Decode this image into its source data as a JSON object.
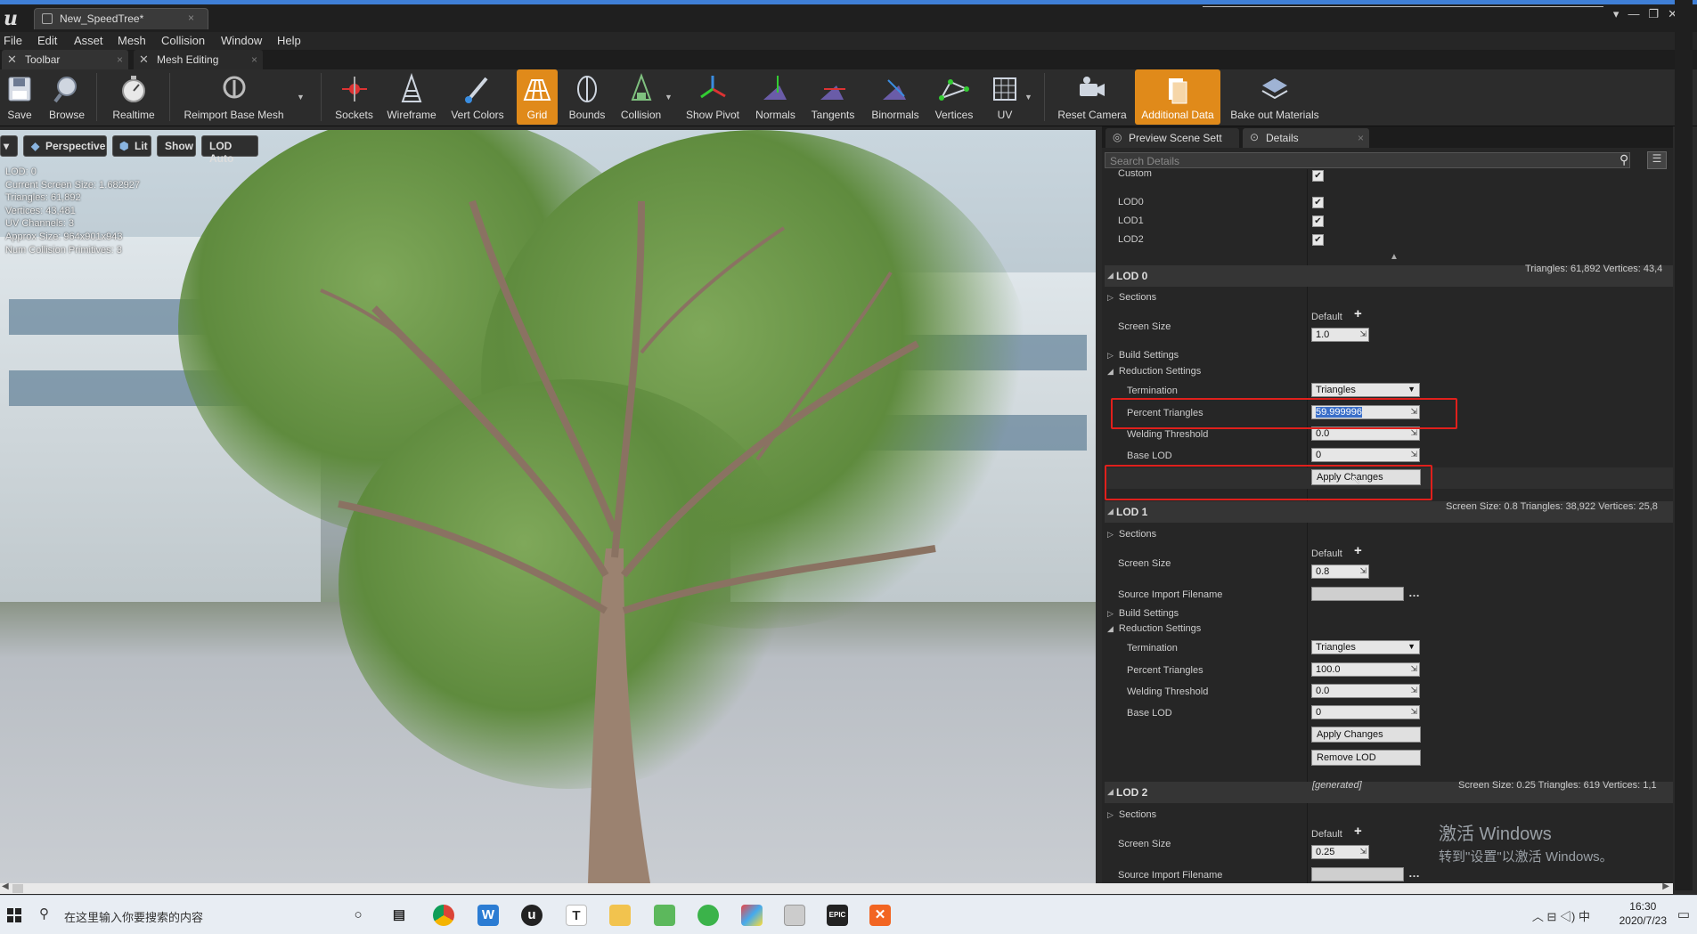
{
  "window": {
    "tab_title": "New_SpeedTree*",
    "tab_close": "×",
    "controls": [
      "▾",
      "—",
      "❐",
      "✕"
    ]
  },
  "menu": [
    "File",
    "Edit",
    "Asset",
    "Mesh",
    "Collision",
    "Window",
    "Help"
  ],
  "panel_tabs": [
    {
      "label": "Toolbar",
      "close": "×"
    },
    {
      "label": "Mesh Editing",
      "close": "×"
    }
  ],
  "toolbar": [
    {
      "label": "Save",
      "icon": "save-icon"
    },
    {
      "label": "Browse",
      "icon": "browse-icon"
    },
    {
      "label": "Realtime",
      "icon": "realtime-icon"
    },
    {
      "label": "Reimport Base Mesh",
      "icon": "reimport-icon"
    },
    {
      "label": "Sockets",
      "icon": "sockets-icon"
    },
    {
      "label": "Wireframe",
      "icon": "wireframe-icon"
    },
    {
      "label": "Vert Colors",
      "icon": "vert-colors-icon"
    },
    {
      "label": "Grid",
      "icon": "grid-icon",
      "active": true
    },
    {
      "label": "Bounds",
      "icon": "bounds-icon"
    },
    {
      "label": "Collision",
      "icon": "collision-icon"
    },
    {
      "label": "Show Pivot",
      "icon": "pivot-icon"
    },
    {
      "label": "Normals",
      "icon": "normals-icon"
    },
    {
      "label": "Tangents",
      "icon": "tangents-icon"
    },
    {
      "label": "Binormals",
      "icon": "binormals-icon"
    },
    {
      "label": "Vertices",
      "icon": "vertices-icon"
    },
    {
      "label": "UV",
      "icon": "uv-icon"
    },
    {
      "label": "Reset Camera",
      "icon": "reset-camera-icon"
    },
    {
      "label": "Additional Data",
      "icon": "additional-data-icon",
      "active": true
    },
    {
      "label": "Bake out Materials",
      "icon": "bake-icon"
    }
  ],
  "viewport": {
    "buttons": [
      "Perspective",
      "Lit",
      "Show",
      "LOD Auto"
    ],
    "stats": [
      "LOD:  0",
      "Current Screen Size:  1.682927",
      "Triangles:  61,892",
      "Vertices:  43,481",
      "UV Channels:  3",
      "Approx Size: 964x901x943",
      "Num Collision Primitives:  3"
    ]
  },
  "details": {
    "tabs": [
      "Preview Scene Sett",
      "Details"
    ],
    "search_placeholder": "Search Details",
    "top_rows": [
      {
        "label": "Custom",
        "checked": "✔"
      },
      {
        "label": "LOD0",
        "checked": "✔"
      },
      {
        "label": "LOD1",
        "checked": "✔"
      },
      {
        "label": "LOD2",
        "checked": "✔"
      }
    ],
    "lod0": {
      "title": "LOD 0",
      "info": "Triangles: 61,892    Vertices: 43,4",
      "sections": "Sections",
      "screen_size_label": "Screen Size",
      "default_label": "Default",
      "screen_size": "1.0",
      "build_settings": "Build Settings",
      "reduction_settings": "Reduction Settings",
      "termination_label": "Termination",
      "termination": "Triangles",
      "percent_label": "Percent Triangles",
      "percent": "59.999996",
      "welding_label": "Welding Threshold",
      "welding": "0.0",
      "base_lod_label": "Base LOD",
      "base_lod": "0",
      "apply": "Apply Changes"
    },
    "lod1": {
      "title": "LOD 1",
      "info": "Screen Size: 0.8    Triangles: 38,922    Vertices: 25,8",
      "sections": "Sections",
      "screen_size_label": "Screen Size",
      "default_label": "Default",
      "screen_size": "0.8",
      "source_label": "Source Import Filename",
      "build_settings": "Build Settings",
      "reduction_settings": "Reduction Settings",
      "termination_label": "Termination",
      "termination": "Triangles",
      "percent_label": "Percent Triangles",
      "percent": "100.0",
      "welding_label": "Welding Threshold",
      "welding": "0.0",
      "base_lod_label": "Base LOD",
      "base_lod": "0",
      "apply": "Apply Changes",
      "remove": "Remove LOD"
    },
    "lod2": {
      "title": "LOD 2",
      "generated": "[generated]",
      "info": "Screen Size: 0.25    Triangles: 619    Vertices: 1,1",
      "sections": "Sections",
      "screen_size_label": "Screen Size",
      "default_label": "Default",
      "screen_size": "0.25",
      "source_label": "Source Import Filename"
    }
  },
  "watermark": {
    "line1": "激活 Windows",
    "line2": "转到\"设置\"以激活 Windows。"
  },
  "taskbar": {
    "search_placeholder": "在这里输入你要搜索的内容",
    "time": "16:30",
    "date": "2020/7/23",
    "ime": "中"
  }
}
